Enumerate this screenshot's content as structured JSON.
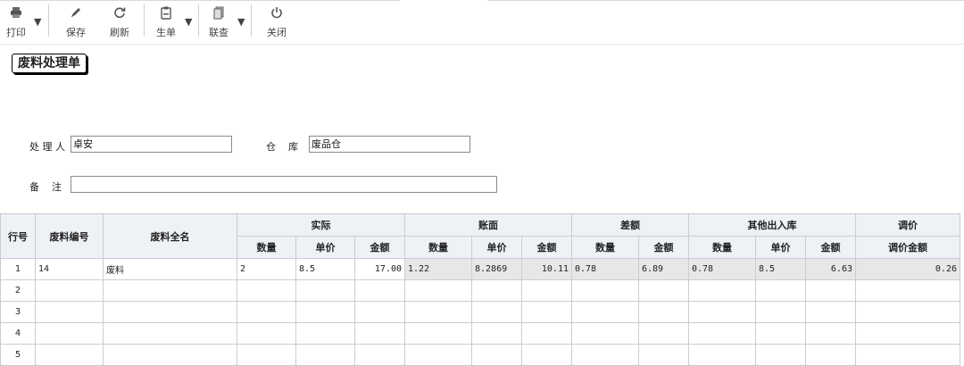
{
  "toolbar": {
    "print": "打印",
    "save": "保存",
    "refresh": "刷新",
    "generate": "生单",
    "link": "联查",
    "close": "关闭"
  },
  "title": "废料处理单",
  "form": {
    "handler_label": "处 理 人",
    "handler_value": "卓安",
    "warehouse_label": "仓    库",
    "warehouse_value": "废品仓",
    "remark_label": "备    注",
    "remark_value": ""
  },
  "grid": {
    "headers": {
      "row_no": "行号",
      "code": "废料编号",
      "name": "废料全名",
      "actual": "实际",
      "book": "账面",
      "diff": "差额",
      "other": "其他出入库",
      "adjust": "调价",
      "qty": "数量",
      "price": "单价",
      "amount": "金额",
      "adjust_amount": "调价金额"
    },
    "rows": [
      {
        "no": "1",
        "code": "14",
        "name": "废料",
        "actual_qty": "2",
        "actual_price": "8.5",
        "actual_amount": "17.00",
        "book_qty": "1.22",
        "book_price": "8.2869",
        "book_amount": "10.11",
        "diff_qty": "0.78",
        "diff_amount": "6.89",
        "other_qty": "0.78",
        "other_price": "8.5",
        "other_amount": "6.63",
        "adjust_amount": "0.26"
      },
      {
        "no": "2"
      },
      {
        "no": "3"
      },
      {
        "no": "4"
      },
      {
        "no": "5"
      }
    ]
  },
  "colors": {
    "header_bg": "#eef1f5",
    "readonly_bg": "#e7e7e7",
    "border": "#c9cdd3"
  }
}
